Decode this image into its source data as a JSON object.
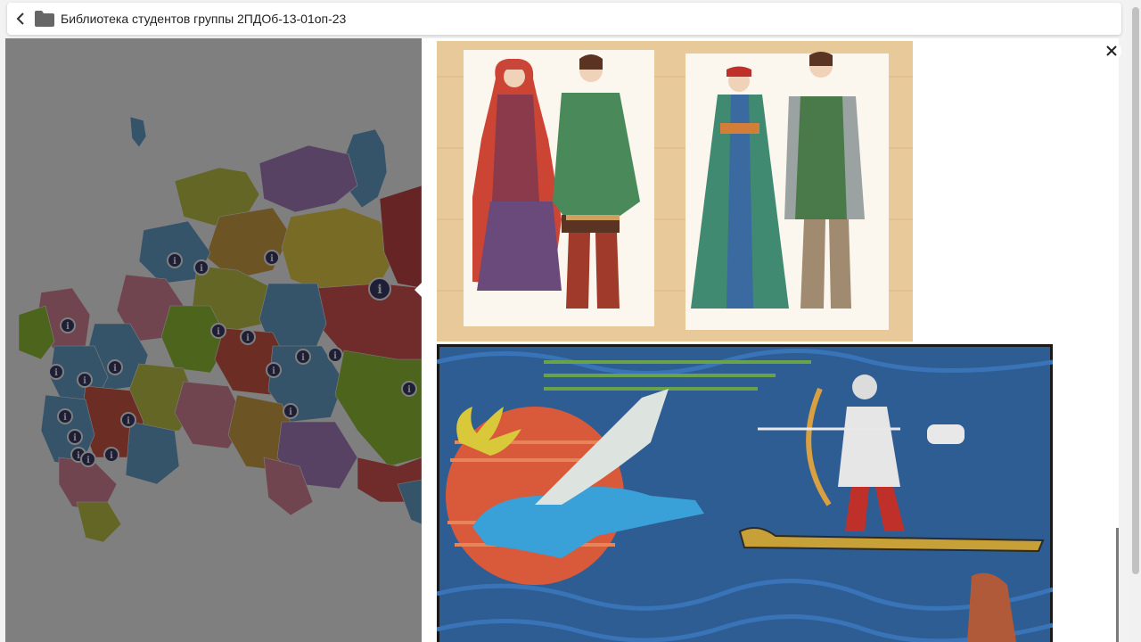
{
  "header": {
    "back_icon": "chevron-left-icon",
    "folder_icon": "folder-icon",
    "title": "Библиотека студентов группы 2ПДОб-13-01оп-23"
  },
  "viewer": {
    "close_icon": "close-icon",
    "images": [
      {
        "name": "folk-costumes-illustration",
        "subject": "traditional costumes"
      },
      {
        "name": "reindeer-archer-illustration",
        "subject": "archer on skis with flying reindeer"
      }
    ]
  },
  "map": {
    "marker_icon": "info-icon",
    "marker_count": 22
  },
  "colors": {
    "overlay": "#808080",
    "header_bg": "#ffffff",
    "text": "#222222"
  }
}
